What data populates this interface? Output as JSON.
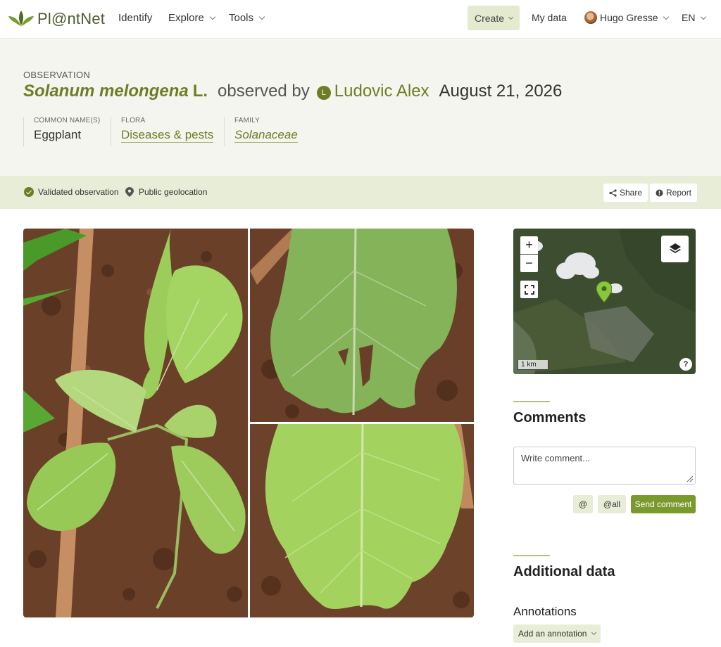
{
  "nav": {
    "logo_text": "Pl@ntNet",
    "items": [
      {
        "label": "Identify"
      },
      {
        "label": "Explore"
      },
      {
        "label": "Tools"
      }
    ],
    "create_label": "Create",
    "my_data_label": "My data",
    "user_name": "Hugo Gresse",
    "language": "EN"
  },
  "observation": {
    "label": "OBSERVATION",
    "species": "Solanum melongena",
    "author": "L.",
    "observed_by": "observed by",
    "user_initial": "L",
    "user_name": "Ludovic Alex",
    "date": "August 21, 2026",
    "meta": {
      "common_name_label": "COMMON NAME(S)",
      "common_name": "Eggplant",
      "flora_label": "FLORA",
      "flora": "Diseases & pests",
      "family_label": "FAMILY",
      "family": "Solanaceae"
    }
  },
  "status": {
    "validated": "Validated observation",
    "geolocation": "Public geolocation",
    "share": "Share",
    "report": "Report"
  },
  "map": {
    "zoom_in": "+",
    "zoom_out": "−",
    "scale": "1 km",
    "help": "?"
  },
  "comments": {
    "title": "Comments",
    "placeholder": "Write comment...",
    "mention": "@",
    "mention_all": "@all",
    "send": "Send comment"
  },
  "additional": {
    "title": "Additional data",
    "annotations_label": "Annotations",
    "add_annotation": "Add an annotation"
  },
  "icons": {
    "logo": "leaf-logo-icon",
    "validated": "check-circle-icon",
    "geolocation": "map-pin-icon",
    "share": "share-icon",
    "report": "alert-icon",
    "layers": "layers-icon",
    "fullscreen": "fullscreen-icon",
    "marker": "map-marker-icon"
  },
  "colors": {
    "brand_green": "#6e7d25",
    "send_button": "#7a9a2e",
    "header_bg": "#f5f5f0",
    "status_bg": "#e7edd6",
    "create_bg": "#e3ead0"
  }
}
